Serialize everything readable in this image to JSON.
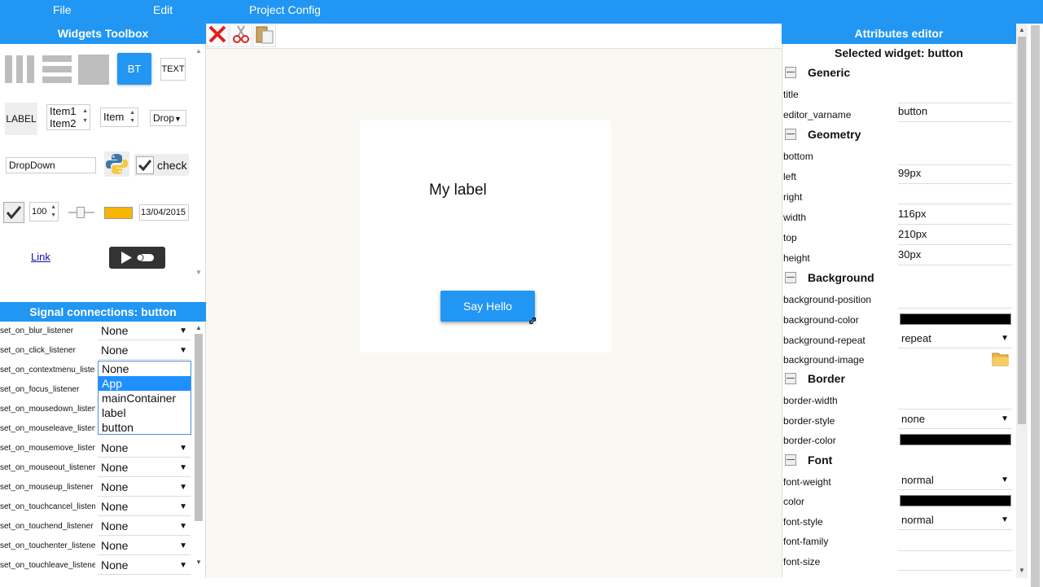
{
  "menu": {
    "file": "File",
    "edit": "Edit",
    "project_config": "Project Config"
  },
  "toolbox": {
    "title": "Widgets Toolbox",
    "bt_label": "BT",
    "text_label": "TEXT",
    "label_label": "LABEL",
    "list_items": [
      "Item1",
      "Item2"
    ],
    "spin_label": "Item",
    "drop_label": "Drop",
    "dropdown_label": "DropDown",
    "check_label": "check",
    "number_value": "100",
    "date_value": "13/04/2015",
    "link_label": "Link",
    "color_value": "#f7b500"
  },
  "signals": {
    "title": "Signal connections: button",
    "rows": [
      {
        "label": "set_on_blur_listener",
        "value": "None"
      },
      {
        "label": "set_on_click_listener",
        "value": "None"
      },
      {
        "label": "set_on_contextmenu_listener",
        "value": ""
      },
      {
        "label": "set_on_focus_listener",
        "value": ""
      },
      {
        "label": "set_on_mousedown_listener",
        "value": ""
      },
      {
        "label": "set_on_mouseleave_listener",
        "value": ""
      },
      {
        "label": "set_on_mousemove_listener",
        "value": "None"
      },
      {
        "label": "set_on_mouseout_listener",
        "value": "None"
      },
      {
        "label": "set_on_mouseup_listener",
        "value": "None"
      },
      {
        "label": "set_on_touchcancel_listener",
        "value": "None"
      },
      {
        "label": "set_on_touchend_listener",
        "value": "None"
      },
      {
        "label": "set_on_touchenter_listener",
        "value": "None"
      },
      {
        "label": "set_on_touchleave_listener",
        "value": "None"
      }
    ],
    "open_list": {
      "options": [
        "None",
        "App",
        "mainContainer",
        "label",
        "button"
      ],
      "selected": "App"
    }
  },
  "canvas": {
    "label_text": "My label",
    "button_text": "Say Hello"
  },
  "toolbar": {
    "icons": [
      "delete-icon",
      "cut-icon",
      "paste-icon"
    ]
  },
  "attributes": {
    "title": "Attributes editor",
    "selected": "Selected widget: button",
    "sections": {
      "generic": "Generic",
      "geometry": "Geometry",
      "background": "Background",
      "border": "Border",
      "font": "Font"
    },
    "fields": {
      "title": {
        "label": "title",
        "value": ""
      },
      "editor_varname": {
        "label": "editor_varname",
        "value": "button"
      },
      "bottom": {
        "label": "bottom",
        "value": ""
      },
      "left": {
        "label": "left",
        "value": "99px"
      },
      "right": {
        "label": "right",
        "value": ""
      },
      "width": {
        "label": "width",
        "value": "116px"
      },
      "top": {
        "label": "top",
        "value": "210px"
      },
      "height": {
        "label": "height",
        "value": "30px"
      },
      "background_position": {
        "label": "background-position",
        "value": ""
      },
      "background_color": {
        "label": "background-color",
        "value": "#000000"
      },
      "background_repeat": {
        "label": "background-repeat",
        "value": "repeat"
      },
      "background_image": {
        "label": "background-image",
        "value": ""
      },
      "border_width": {
        "label": "border-width",
        "value": ""
      },
      "border_style": {
        "label": "border-style",
        "value": "none"
      },
      "border_color": {
        "label": "border-color",
        "value": "#000000"
      },
      "font_weight": {
        "label": "font-weight",
        "value": "normal"
      },
      "color": {
        "label": "color",
        "value": "#000000"
      },
      "font_style": {
        "label": "font-style",
        "value": "normal"
      },
      "font_family": {
        "label": "font-family",
        "value": ""
      },
      "font_size": {
        "label": "font-size",
        "value": ""
      }
    }
  },
  "colors": {
    "accent": "#2196f3",
    "canvas_bg": "#f9f8f3"
  }
}
